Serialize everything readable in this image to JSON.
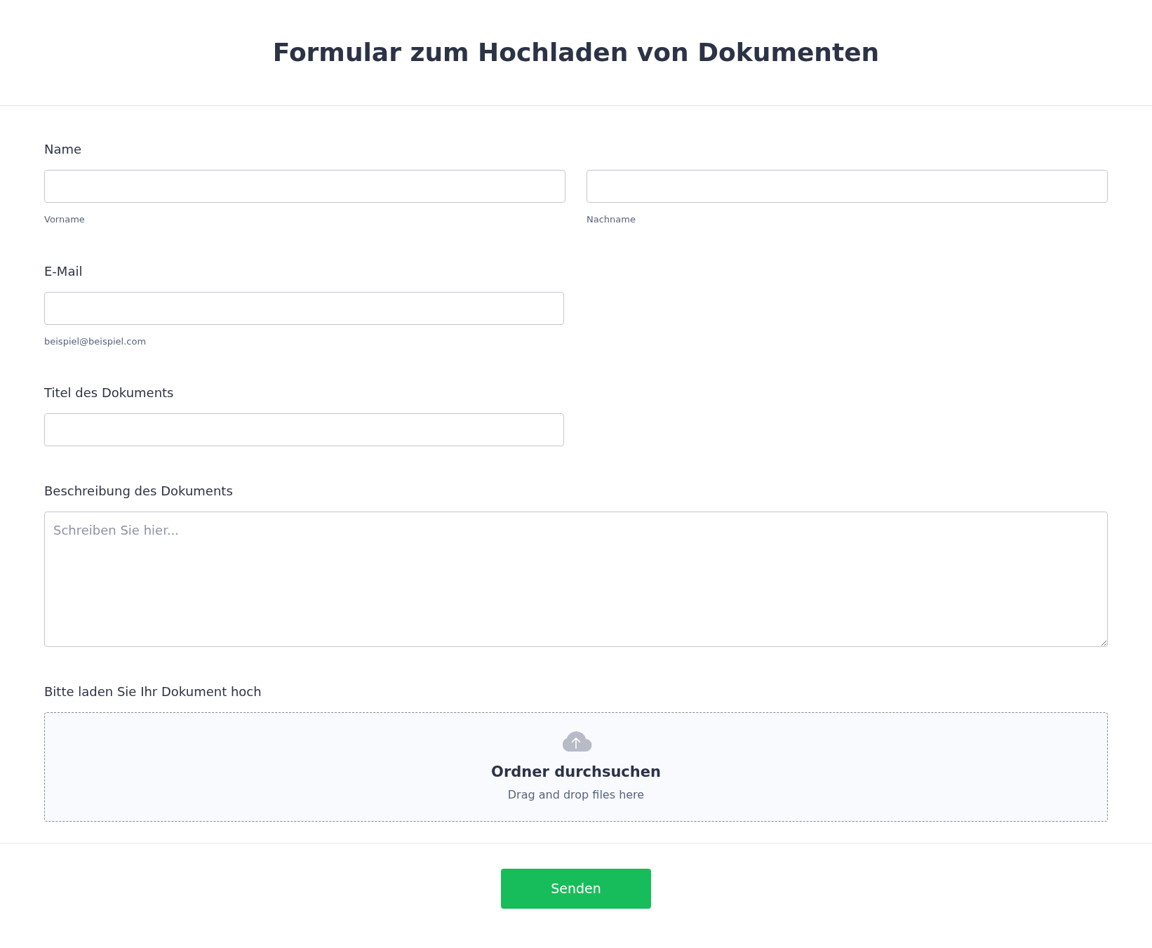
{
  "title": "Formular zum Hochladen von Dokumenten",
  "fields": [
    {
      "kind": "name",
      "label": "Name",
      "inputs": [
        {
          "sublabel": "Vorname"
        },
        {
          "sublabel": "Nachname"
        }
      ]
    },
    {
      "kind": "text",
      "label": "E-Mail",
      "sublabel": "beispiel@beispiel.com"
    },
    {
      "kind": "text",
      "label": "Titel des Dokuments"
    },
    {
      "kind": "textarea",
      "label": "Beschreibung des Dokuments",
      "placeholder": "Schreiben Sie hier..."
    },
    {
      "kind": "upload",
      "label": "Bitte laden Sie Ihr Dokument hoch",
      "button": "Ordner durchsuchen",
      "hint": "Drag and drop files here"
    }
  ],
  "submit": "Senden"
}
